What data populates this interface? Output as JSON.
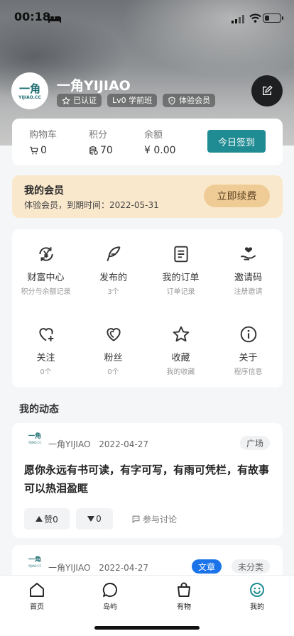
{
  "status_bar": {
    "time": "00:18"
  },
  "profile": {
    "name": "一角YIJIAO",
    "logo_text": "一角",
    "logo_sub": "YIJIAO.CC",
    "badges": [
      {
        "icon": "star-outline-icon",
        "label": "已认证"
      },
      {
        "icon": "",
        "label": "Lv0 学前班"
      },
      {
        "icon": "shield-icon",
        "label": "体验会员"
      }
    ]
  },
  "stats": {
    "cart": {
      "label": "购物车",
      "value": "0"
    },
    "points": {
      "label": "积分",
      "value": "70"
    },
    "balance": {
      "label": "余额",
      "value": "¥ 0.00"
    },
    "checkin_label": "今日签到"
  },
  "vip": {
    "title": "我的会员",
    "subtitle": "体验会员，到期时间：2022-05-31",
    "renew_label": "立即续费"
  },
  "grid": [
    {
      "icon": "yen-cycle-icon",
      "name": "财富中心",
      "desc": "积分与余额记录"
    },
    {
      "icon": "feather-icon",
      "name": "发布的",
      "desc": "3个"
    },
    {
      "icon": "order-list-icon",
      "name": "我的订单",
      "desc": "订单记录"
    },
    {
      "icon": "hand-heart-icon",
      "name": "邀请码",
      "desc": "注册邀请"
    },
    {
      "icon": "heart-plus-icon",
      "name": "关注",
      "desc": "0个"
    },
    {
      "icon": "heart-double-icon",
      "name": "粉丝",
      "desc": "0个"
    },
    {
      "icon": "star-icon",
      "name": "收藏",
      "desc": "我的收藏"
    },
    {
      "icon": "info-icon",
      "name": "关于",
      "desc": "程序信息"
    }
  ],
  "section_title": "我的动态",
  "posts": [
    {
      "author": "一角YIJIAO",
      "date": "2022-04-27",
      "tags": [
        "广场"
      ],
      "text": "愿你永远有书可读，有字可写，有雨可凭栏，有故事可以热泪盈眶",
      "likes_label": "赞0",
      "dislikes": "0",
      "discuss_label": "参与讨论"
    },
    {
      "author": "一角YIJIAO",
      "date": "2022-04-27",
      "tags": [
        "文章",
        "未分类"
      ]
    }
  ],
  "tabbar": [
    {
      "icon": "home-icon",
      "label": "首页"
    },
    {
      "icon": "island-chat-icon",
      "label": "岛屿"
    },
    {
      "icon": "shopping-bag-icon",
      "label": "有物"
    },
    {
      "icon": "smile-icon",
      "label": "我的"
    }
  ],
  "colors": {
    "accent": "#1f8b92",
    "vip_bg": "#fae8cc",
    "renew_bg": "#efcc96",
    "tag_active": "#1a73e8",
    "tab_active": "#1f8b92"
  }
}
